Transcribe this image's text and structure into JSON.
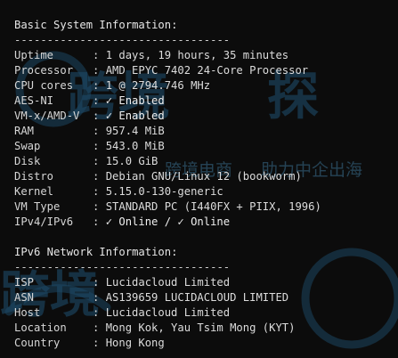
{
  "terminal": {
    "basic": {
      "title": "Basic System Information:",
      "divider": "---------------------------------",
      "rows": [
        {
          "label": "Uptime",
          "value": "1 days, 19 hours, 35 minutes"
        },
        {
          "label": "Processor",
          "value": "AMD EPYC 7402 24-Core Processor"
        },
        {
          "label": "CPU cores",
          "value": "1 @ 2794.746 MHz"
        },
        {
          "label": "AES-NI",
          "value": "✓ Enabled"
        },
        {
          "label": "VM-x/AMD-V",
          "value": "✓ Enabled"
        },
        {
          "label": "RAM",
          "value": "957.4 MiB"
        },
        {
          "label": "Swap",
          "value": "543.0 MiB"
        },
        {
          "label": "Disk",
          "value": "15.0 GiB"
        },
        {
          "label": "Distro",
          "value": "Debian GNU/Linux 12 (bookworm)"
        },
        {
          "label": "Kernel",
          "value": "5.15.0-130-generic"
        },
        {
          "label": "VM Type",
          "value": "STANDARD PC (I440FX + PIIX, 1996)"
        },
        {
          "label": "IPv4/IPv6",
          "value": "✓ Online / ✓ Online"
        }
      ]
    },
    "network": {
      "title": "IPv6 Network Information:",
      "divider": "---------------------------------",
      "rows": [
        {
          "label": "ISP",
          "value": "Lucidacloud Limited"
        },
        {
          "label": "ASN",
          "value": "AS139659 LUCIDACLOUD LIMITED"
        },
        {
          "label": "Host",
          "value": "Lucidacloud Limited"
        },
        {
          "label": "Location",
          "value": "Mong Kok, Yau Tsim Mong (KYT)"
        },
        {
          "label": "Country",
          "value": "Hong Kong"
        }
      ]
    },
    "separator": ": "
  },
  "watermark": {
    "text_top": "跨境",
    "text_right": "探",
    "slogan": "助力中企出海",
    "slogan_left": "跨境电商",
    "text_bottom": "跨境",
    "color": "#1e4a66"
  }
}
